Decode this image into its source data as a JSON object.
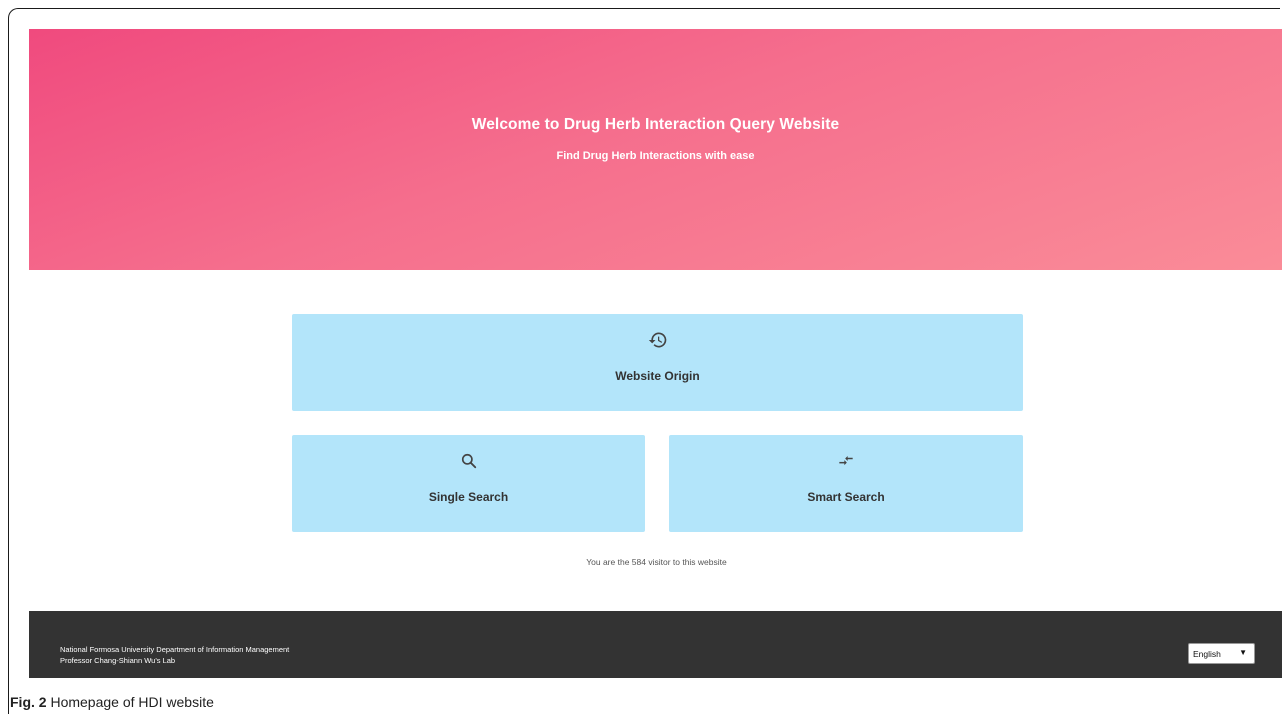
{
  "hero": {
    "title": "Welcome to Drug Herb Interaction Query Website",
    "subtitle": "Find Drug Herb Interactions with ease"
  },
  "cards": {
    "origin": {
      "label": "Website Origin",
      "icon": "history-icon"
    },
    "single": {
      "label": "Single Search",
      "icon": "search-icon"
    },
    "smart": {
      "label": "Smart Search",
      "icon": "compare-arrows-icon"
    }
  },
  "visitor": {
    "text": "You are the 584 visitor to this website"
  },
  "footer": {
    "line1": "National Formosa University Department of Information Management",
    "line2": "Professor Chang-Shiann Wu's Lab",
    "language": {
      "selected": "English",
      "arrow": "▼"
    }
  },
  "caption": {
    "fig": "Fig. 2",
    "text": " Homepage of HDI website"
  },
  "colors": {
    "hero_start": "#f04a7e",
    "hero_end": "#fa8c98",
    "card_bg": "#b3e5fa",
    "footer_bg": "#333333"
  }
}
